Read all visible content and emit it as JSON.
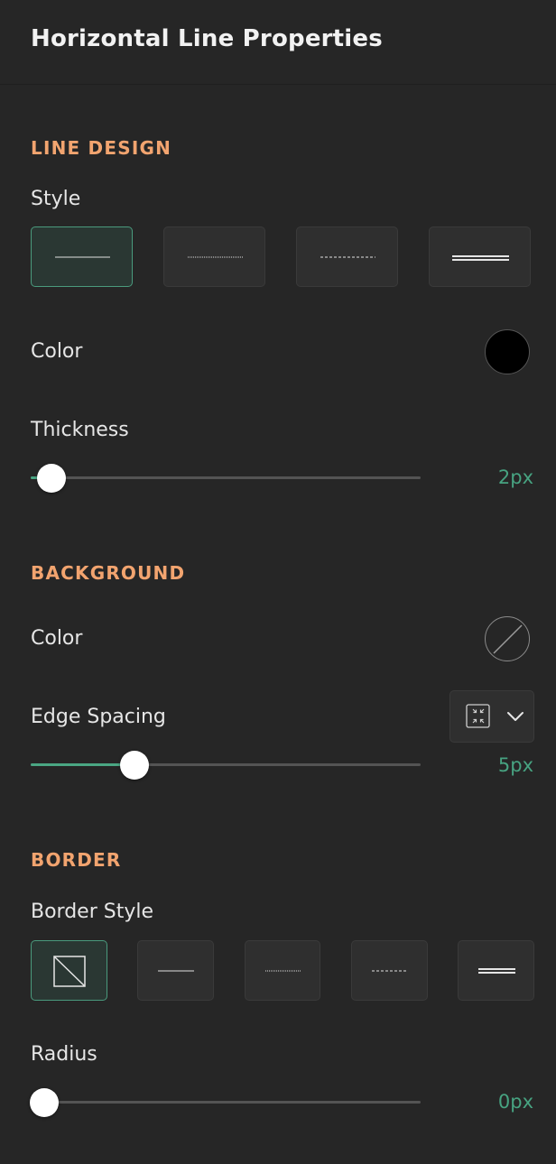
{
  "header": {
    "title": "Horizontal Line Properties"
  },
  "line_design": {
    "section_title": "LINE DESIGN",
    "style_label": "Style",
    "styles": [
      {
        "name": "solid",
        "selected": true
      },
      {
        "name": "dotted",
        "selected": false
      },
      {
        "name": "dashed",
        "selected": false
      },
      {
        "name": "double",
        "selected": false
      }
    ],
    "color_label": "Color",
    "color_value": "#000000",
    "thickness_label": "Thickness",
    "thickness_value": "2px",
    "thickness_level": 0.05
  },
  "background": {
    "section_title": "BACKGROUND",
    "color_label": "Color",
    "color_value": "none",
    "edge_spacing_label": "Edge Spacing",
    "edge_spacing_icon": "compress-icon",
    "edge_spacing_value": "5px",
    "edge_spacing_level": 0.27
  },
  "border": {
    "section_title": "BORDER",
    "border_style_label": "Border Style",
    "styles": [
      {
        "name": "none",
        "selected": true
      },
      {
        "name": "solid",
        "selected": false
      },
      {
        "name": "dotted",
        "selected": false
      },
      {
        "name": "dashed",
        "selected": false
      },
      {
        "name": "double",
        "selected": false
      }
    ],
    "radius_label": "Radius",
    "radius_value": "0px",
    "radius_level": 0
  },
  "colors": {
    "accent": "#47a381",
    "section": "#f2a46f",
    "background": "#262626"
  }
}
